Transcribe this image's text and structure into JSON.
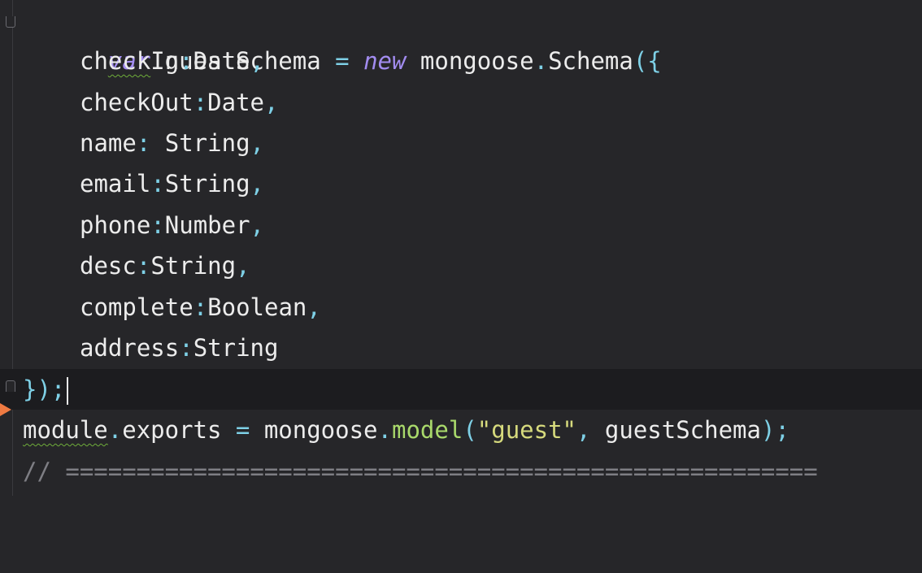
{
  "editor": {
    "lines": [
      {
        "kw": "var",
        "name": "guestSchema",
        "eq": " = ",
        "kw2": "new",
        "obj": " mongoose",
        "dot": ".",
        "cls": "Schema",
        "open": "({"
      },
      {
        "key": "checkIn",
        "colon": ":",
        "type": "Date",
        "comma": ","
      },
      {
        "key": "checkOut",
        "colon": ":",
        "type": "Date",
        "comma": ","
      },
      {
        "key": "name",
        "colon": ": ",
        "type": "String",
        "comma": ","
      },
      {
        "key": "email",
        "colon": ":",
        "type": "String",
        "comma": ","
      },
      {
        "key": "phone",
        "colon": ":",
        "type": "Number",
        "comma": ","
      },
      {
        "key": "desc",
        "colon": ":",
        "type": "String",
        "comma": ","
      },
      {
        "key": "complete",
        "colon": ":",
        "type": "Boolean",
        "comma": ","
      },
      {
        "key": "address",
        "colon": ":",
        "type": "String",
        "comma": ""
      },
      {
        "close": "});"
      },
      {
        "module": "module",
        "dot1": ".",
        "exports": "exports",
        "eq": " = ",
        "mongoose": "mongoose",
        "dot2": ".",
        "model": "model",
        "paren": "(",
        "str": "\"guest\"",
        "sep": ", ",
        "arg": "guestSchema",
        "end": ");"
      },
      {
        "comment": "// ====================================================="
      }
    ]
  },
  "colors": {
    "background": "#262629",
    "current_line": "#1c1c1f",
    "keyword": "#a28cf0",
    "punctuation": "#7ed0e6",
    "function": "#a9d96b",
    "string": "#d6da7d",
    "comment": "#7e7e84",
    "marker": "#ef7a42"
  }
}
